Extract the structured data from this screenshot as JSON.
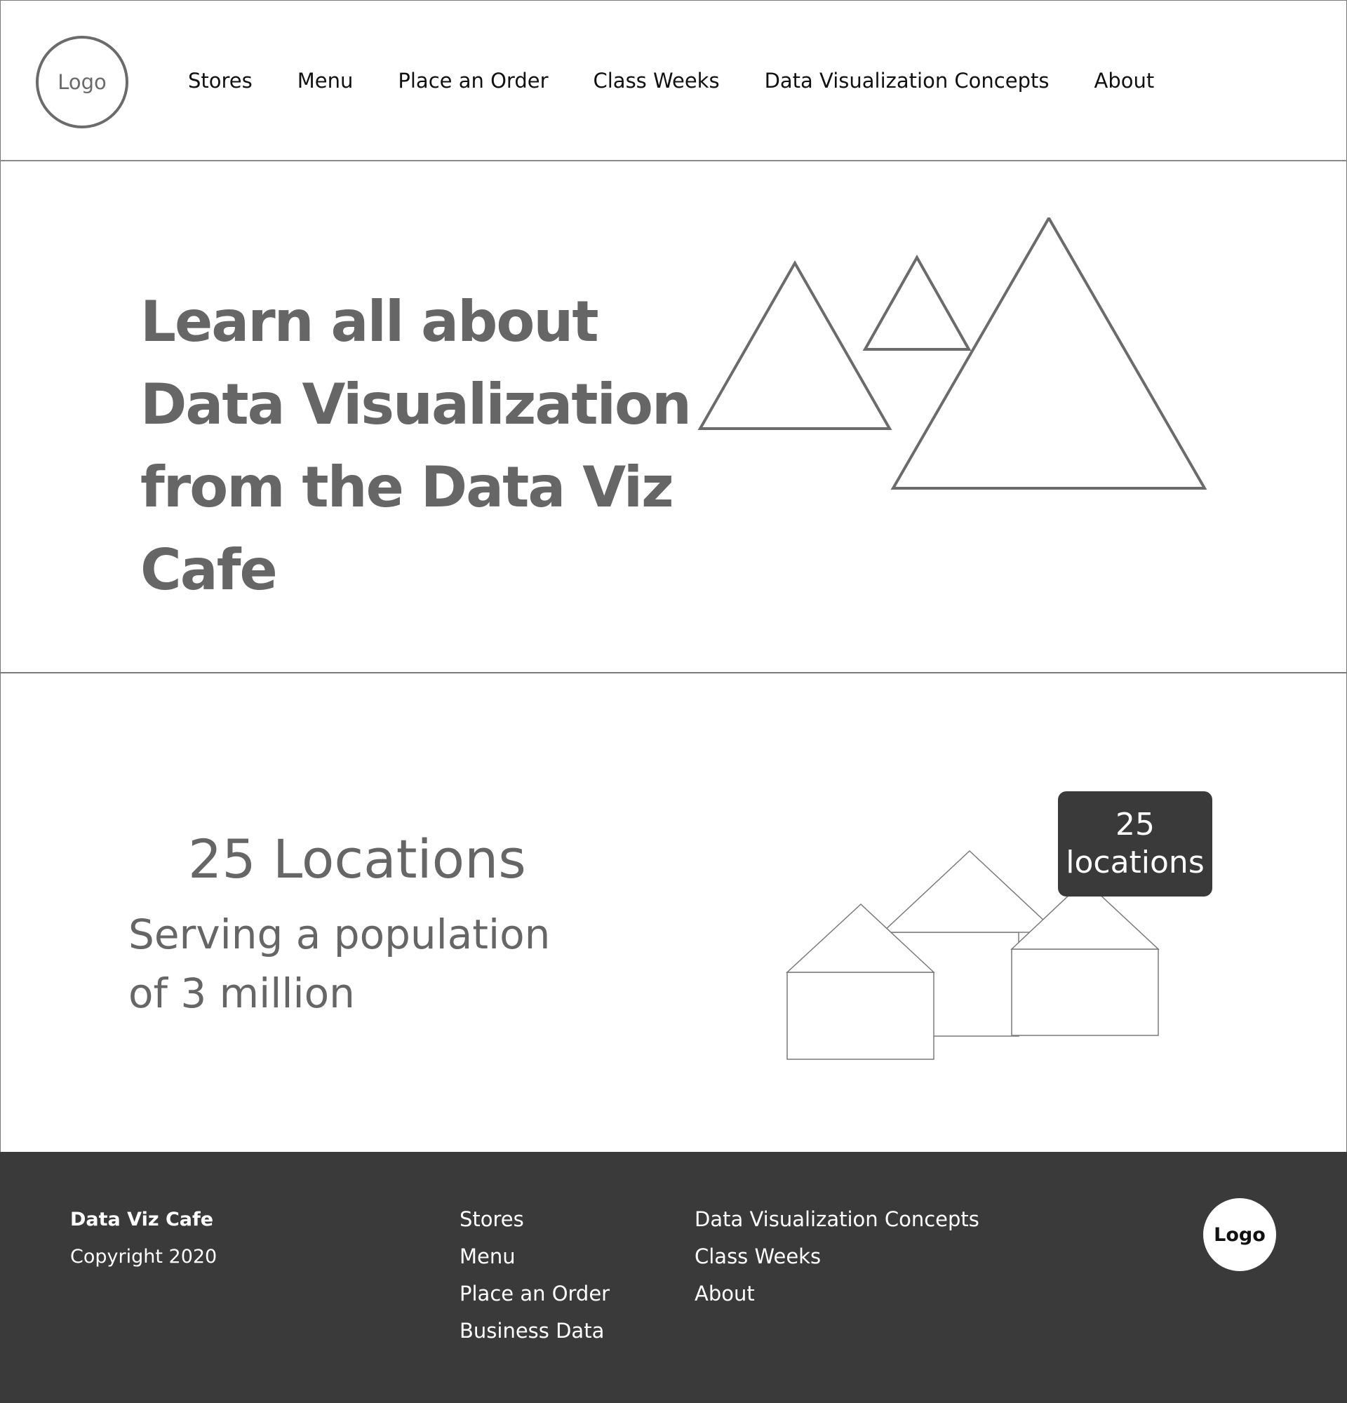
{
  "header": {
    "logo_label": "Logo",
    "nav": [
      "Stores",
      "Menu",
      "Place an Order",
      "Class Weeks",
      "Data Visualization Concepts",
      "About"
    ]
  },
  "hero": {
    "title": "Learn all about Data Visualization from the Data Viz Cafe"
  },
  "locations": {
    "title": "25 Locations",
    "subtitle": "Serving a population of 3 million",
    "badge_number": "25",
    "badge_label": "locations"
  },
  "footer": {
    "brand": "Data Viz Cafe",
    "copyright": "Copyright 2020",
    "links_col1": [
      "Stores",
      "Menu",
      "Place an Order",
      "Business Data"
    ],
    "links_col2": [
      "Data Visualization Concepts",
      "Class Weeks",
      "About"
    ],
    "logo_label": "Logo"
  },
  "colors": {
    "text_gray": "#666666",
    "footer_bg": "#3a3a3a",
    "outline": "#6b6b6b"
  }
}
